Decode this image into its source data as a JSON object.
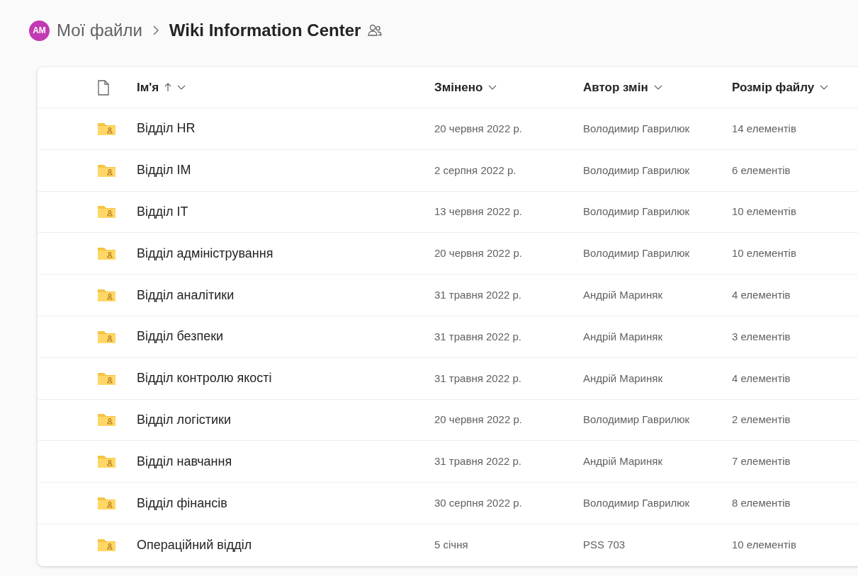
{
  "breadcrumb": {
    "avatar_initials": "AM",
    "parent": "Мої файли",
    "current": "Wiki Information Center"
  },
  "table": {
    "columns": [
      {
        "label": "Ім'я",
        "sorted": true
      },
      {
        "label": "Змінено",
        "sorted": false
      },
      {
        "label": "Автор змін",
        "sorted": false
      },
      {
        "label": "Розмір файлу",
        "sorted": false
      }
    ],
    "rows": [
      {
        "name": "Відділ HR",
        "modified": "20 червня 2022 р.",
        "author": "Володимир Гаврилюк",
        "size": "14 елементів"
      },
      {
        "name": "Відділ IM",
        "modified": "2 серпня 2022 р.",
        "author": "Володимир Гаврилюк",
        "size": "6 елементів"
      },
      {
        "name": "Відділ IT",
        "modified": "13 червня 2022 р.",
        "author": "Володимир Гаврилюк",
        "size": "10 елементів"
      },
      {
        "name": "Відділ адміністрування",
        "modified": "20 червня 2022 р.",
        "author": "Володимир Гаврилюк",
        "size": "10 елементів"
      },
      {
        "name": "Відділ аналітики",
        "modified": "31 травня 2022 р.",
        "author": "Андрій Мариняк",
        "size": "4 елементів"
      },
      {
        "name": "Відділ безпеки",
        "modified": "31 травня 2022 р.",
        "author": "Андрій Мариняк",
        "size": "3 елементів"
      },
      {
        "name": "Відділ контролю якості",
        "modified": "31 травня 2022 р.",
        "author": "Андрій Мариняк",
        "size": "4 елементів"
      },
      {
        "name": "Відділ логістики",
        "modified": "20 червня 2022 р.",
        "author": "Володимир Гаврилюк",
        "size": "2 елементів"
      },
      {
        "name": "Відділ навчання",
        "modified": "31 травня 2022 р.",
        "author": "Андрій Мариняк",
        "size": "7 елементів"
      },
      {
        "name": "Відділ фінансів",
        "modified": "30 серпня 2022 р.",
        "author": "Володимир Гаврилюк",
        "size": "8 елементів"
      },
      {
        "name": "Операційний відділ",
        "modified": "5 січня",
        "author": "PSS 703",
        "size": "10 елементів"
      }
    ]
  }
}
